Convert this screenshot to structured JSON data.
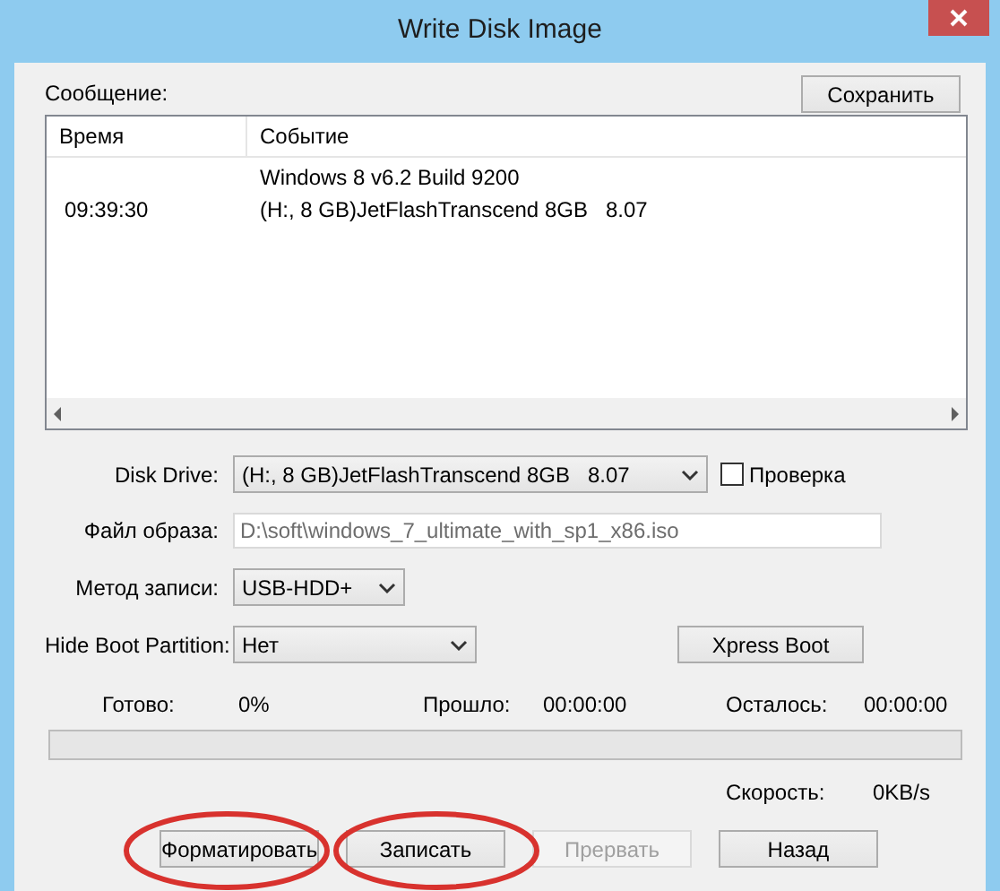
{
  "window": {
    "title": "Write Disk Image"
  },
  "log": {
    "label": "Сообщение:",
    "save_button": "Сохранить",
    "columns": [
      "Время",
      "Событие"
    ],
    "rows": [
      {
        "time": "",
        "event": "Windows 8 v6.2 Build 9200"
      },
      {
        "time": "09:39:30",
        "event": "(H:, 8 GB)JetFlashTranscend 8GB   8.07"
      }
    ]
  },
  "disk_drive": {
    "label": "Disk Drive:",
    "value": "(H:, 8 GB)JetFlashTranscend 8GB   8.07"
  },
  "verify": {
    "label": "Проверка",
    "checked": false
  },
  "image_file": {
    "label": "Файл образа:",
    "value": "D:\\soft\\windows_7_ultimate_with_sp1_x86.iso",
    "disabled": true
  },
  "write_method": {
    "label": "Метод записи:",
    "value": "USB-HDD+"
  },
  "hide_boot": {
    "label": "Hide Boot Partition:",
    "value": "Нет"
  },
  "xpress_boot": "Xpress Boot",
  "progress": {
    "done_label": "Готово:",
    "done": "0%",
    "elapsed_label": "Прошло:",
    "elapsed": "00:00:00",
    "remaining_label": "Осталось:",
    "remaining": "00:00:00",
    "speed_label": "Скорость:",
    "speed": "0KB/s"
  },
  "buttons": [
    {
      "label": "Форматировать",
      "disabled": false,
      "circled": true
    },
    {
      "label": "Записать",
      "disabled": false,
      "circled": true
    },
    {
      "label": "Прервать",
      "disabled": true,
      "circled": false
    },
    {
      "label": "Назад",
      "disabled": false,
      "circled": false
    }
  ]
}
